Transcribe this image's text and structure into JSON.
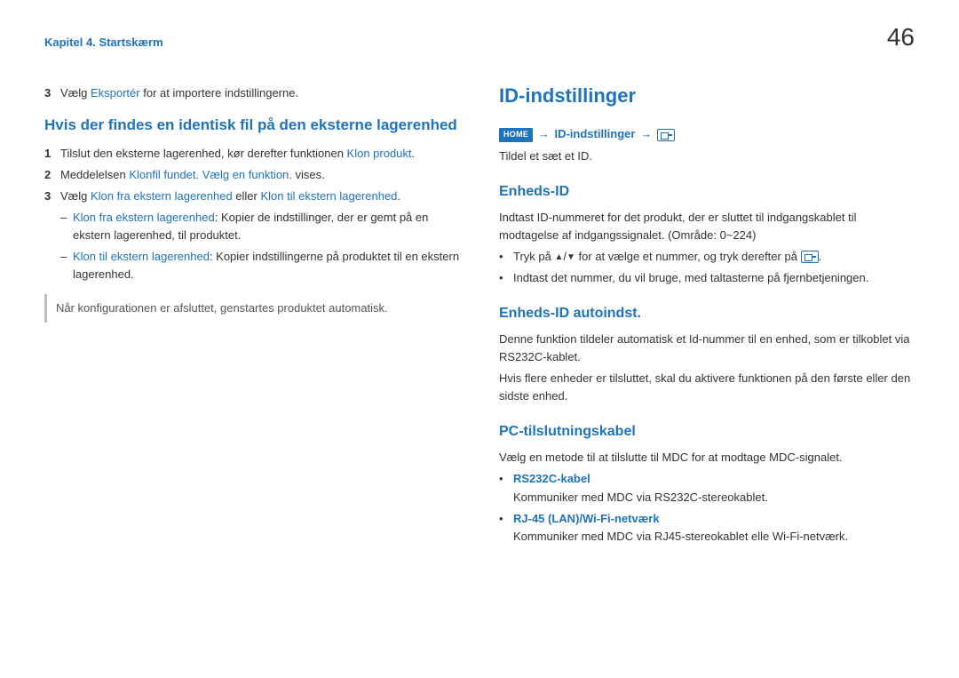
{
  "header": {
    "chapter": "Kapitel 4. Startskærm",
    "page": "46"
  },
  "left": {
    "step3": {
      "num": "3",
      "pre": "Vælg ",
      "link": "Eksportér",
      "post": " for at importere indstillingerne."
    },
    "subheading": "Hvis der findes en identisk fil på den eksterne lagerenhed",
    "s1": {
      "num": "1",
      "pre": "Tilslut den eksterne lagerenhed, kør derefter funktionen ",
      "link": "Klon produkt",
      "post": "."
    },
    "s2": {
      "num": "2",
      "pre": "Meddelelsen ",
      "link": "Klonfil fundet. Vælg en funktion.",
      "post": " vises."
    },
    "s3": {
      "num": "3",
      "pre": "Vælg ",
      "link1": "Klon fra ekstern lagerenhed",
      "mid": " eller ",
      "link2": "Klon til ekstern lagerenhed",
      "post": "."
    },
    "sub1": {
      "link": "Klon fra ekstern lagerenhed",
      "text": ": Kopier de indstillinger, der er gemt på en ekstern lagerenhed, til produktet."
    },
    "sub2": {
      "link": "Klon til ekstern lagerenhed",
      "text": ": Kopier indstillingerne på produktet til en ekstern lagerenhed."
    },
    "note": "Når konfigurationen er afsluttet, genstartes produktet automatisk."
  },
  "right": {
    "title": "ID-indstillinger",
    "crumb": {
      "home": "HOME",
      "mid": "ID-indstillinger"
    },
    "crumb_after": "Tildel et sæt et ID.",
    "sec1": {
      "h": "Enheds-ID",
      "p": "Indtast ID-nummeret for det produkt, der er sluttet til indgangskablet til modtagelse af indgangssignalet. (Område: 0~224)",
      "b1a": "Tryk på ",
      "b1b": " for at vælge et nummer, og tryk derefter på ",
      "b1c": ".",
      "b2": "Indtast det nummer, du vil bruge, med taltasterne på fjernbetjeningen."
    },
    "sec2": {
      "h": "Enheds-ID autoindst.",
      "p1": "Denne funktion tildeler automatisk et Id-nummer til en enhed, som er tilkoblet via RS232C-kablet.",
      "p2": "Hvis flere enheder er tilsluttet, skal du aktivere funktionen på den første eller den sidste enhed."
    },
    "sec3": {
      "h": "PC-tilslutningskabel",
      "p": "Vælg en metode til at tilslutte til MDC for at modtage MDC-signalet.",
      "o1": {
        "name": "RS232C-kabel",
        "desc": "Kommuniker med MDC via RS232C-stereokablet."
      },
      "o2": {
        "name": "RJ-45 (LAN)/Wi-Fi-netværk",
        "desc": "Kommuniker med MDC via RJ45-stereokablet elle Wi-Fi-netværk."
      }
    }
  }
}
